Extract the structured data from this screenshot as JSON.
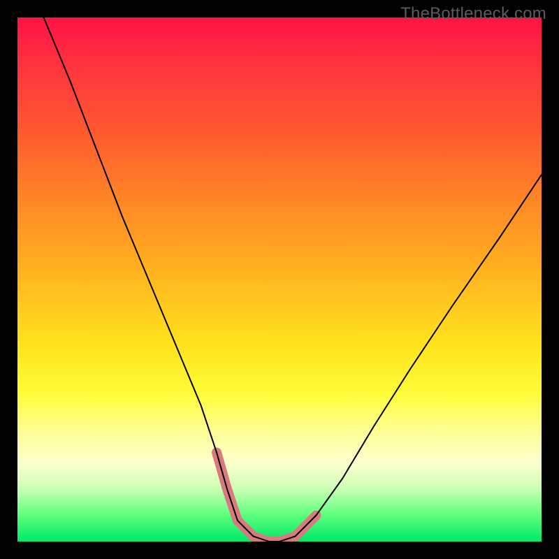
{
  "watermark": "TheBottleneck.com",
  "chart_data": {
    "type": "line",
    "title": "",
    "xlabel": "",
    "ylabel": "",
    "xlim": [
      0,
      100
    ],
    "ylim": [
      0,
      100
    ],
    "grid": false,
    "legend": false,
    "background_gradient": {
      "orientation": "vertical",
      "stops": [
        {
          "pos": 0,
          "meaning": "worst",
          "color": "#ff1246"
        },
        {
          "pos": 50,
          "meaning": "mid",
          "color": "#ffb81f"
        },
        {
          "pos": 100,
          "meaning": "best",
          "color": "#00e86a"
        }
      ]
    },
    "series": [
      {
        "name": "bottleneck-curve",
        "color": "#000000",
        "stroke_width": 2,
        "x": [
          5,
          10,
          15,
          20,
          25,
          30,
          35,
          38,
          40,
          42,
          45,
          48,
          50,
          53,
          57,
          62,
          68,
          75,
          83,
          92,
          100
        ],
        "values": [
          100,
          88,
          75,
          62,
          50,
          38,
          26,
          17,
          10,
          4,
          1,
          0,
          0,
          1,
          5,
          12,
          22,
          33,
          45,
          58,
          70
        ]
      },
      {
        "name": "optimal-zone-highlight",
        "color": "#d97b7e",
        "stroke_width": 14,
        "x": [
          38,
          40,
          42,
          45,
          48,
          50,
          53,
          55,
          57
        ],
        "values": [
          17,
          10,
          4,
          1,
          0,
          0,
          1,
          3,
          5
        ]
      }
    ]
  }
}
